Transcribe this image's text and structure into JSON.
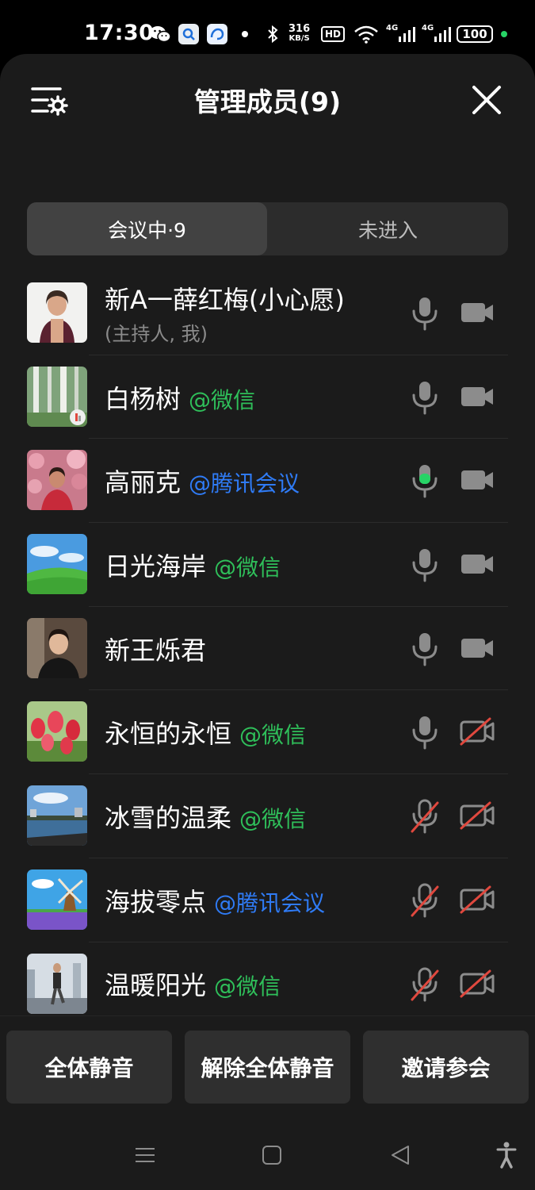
{
  "status_bar": {
    "time": "17:30",
    "net_speed_value": "316",
    "net_speed_unit": "KB/S",
    "hd_label": "HD",
    "network_1": "4G",
    "network_2": "4G",
    "battery": "100"
  },
  "header": {
    "title": "管理成员(9)"
  },
  "tabs": [
    {
      "label": "会议中·9",
      "active": true
    },
    {
      "label": "未进入",
      "active": false
    }
  ],
  "members": [
    {
      "name": "新A一薛红梅(小心愿)",
      "sub": "(主持人, 我)",
      "source": "",
      "source_color": "",
      "mic": "muted",
      "camera": "off",
      "avatar": "portrait-woman-white"
    },
    {
      "name": "白杨树",
      "sub": "",
      "source": "@微信",
      "source_color": "#2fbf5a",
      "mic": "muted",
      "camera": "off",
      "avatar": "birch-trees"
    },
    {
      "name": "高丽克",
      "sub": "",
      "source": "@腾讯会议",
      "source_color": "#2f7bf5",
      "mic": "speaking",
      "camera": "off",
      "avatar": "flowers-portrait"
    },
    {
      "name": "日光海岸",
      "sub": "",
      "source": "@微信",
      "source_color": "#2fbf5a",
      "mic": "muted",
      "camera": "off",
      "avatar": "green-field-sky"
    },
    {
      "name": "新王烁君",
      "sub": "",
      "source": "",
      "source_color": "",
      "mic": "muted",
      "camera": "off",
      "avatar": "portrait-woman-dark"
    },
    {
      "name": "永恒的永恒",
      "sub": "",
      "source": "@微信",
      "source_color": "#2fbf5a",
      "mic": "muted",
      "camera": "disabled",
      "avatar": "tulips"
    },
    {
      "name": "冰雪的温柔",
      "sub": "",
      "source": "@微信",
      "source_color": "#2fbf5a",
      "mic": "disabled",
      "camera": "disabled",
      "avatar": "lake-city"
    },
    {
      "name": "海拔零点",
      "sub": "",
      "source": "@腾讯会议",
      "source_color": "#2f7bf5",
      "mic": "disabled",
      "camera": "disabled",
      "avatar": "windmill-lavender"
    },
    {
      "name": "温暖阳光",
      "sub": "",
      "source": "@微信",
      "source_color": "#2fbf5a",
      "mic": "disabled",
      "camera": "disabled",
      "avatar": "runner-city"
    }
  ],
  "actions": {
    "mute_all": "全体静音",
    "unmute_all": "解除全体静音",
    "invite": "邀请参会"
  },
  "icons": {
    "settings": "list-settings-icon",
    "close": "close-icon",
    "mic": "microphone-icon",
    "camera": "video-camera-icon",
    "nav_menu": "menu-icon",
    "nav_home": "home-square-icon",
    "nav_back": "back-triangle-icon",
    "nav_accessibility": "accessibility-icon"
  },
  "colors": {
    "wechat_green": "#2fbf5a",
    "tencent_blue": "#2f7bf5",
    "disabled_red": "#e0483e",
    "speaking_green": "#27d466"
  }
}
